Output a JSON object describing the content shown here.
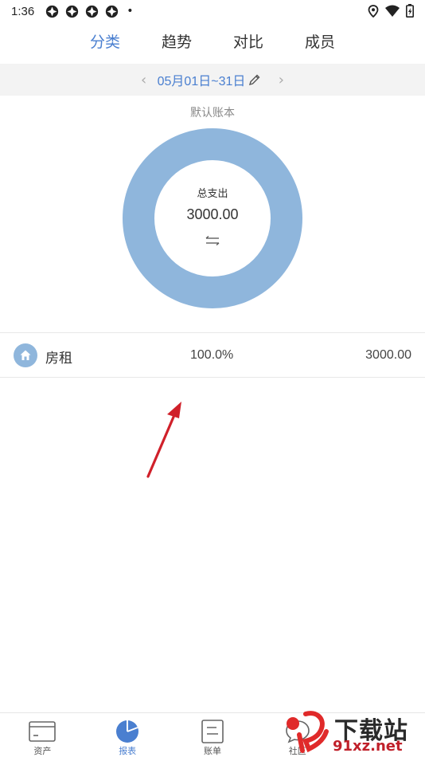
{
  "status_bar": {
    "time": "1:36",
    "dot": "•"
  },
  "top_tabs": [
    {
      "label": "分类",
      "active": true
    },
    {
      "label": "趋势",
      "active": false
    },
    {
      "label": "对比",
      "active": false
    },
    {
      "label": "成员",
      "active": false
    }
  ],
  "date_bar": {
    "prev": "‹",
    "range": "05月01日~31日",
    "next": "›"
  },
  "chart": {
    "ledger_name": "默认账本",
    "center_label": "总支出",
    "center_total": "3000.00",
    "ring_color": "#8fb6dc"
  },
  "chart_data": {
    "type": "pie",
    "categories": [
      "房租"
    ],
    "values": [
      3000.0
    ],
    "title": "默认账本"
  },
  "categories": [
    {
      "name": "房租",
      "percent": "100.0%",
      "amount": "3000.00",
      "icon": "home-icon"
    }
  ],
  "bottom_nav": [
    {
      "label": "资产",
      "icon": "card-icon",
      "active": false
    },
    {
      "label": "报表",
      "icon": "pie-chart-icon",
      "active": true
    },
    {
      "label": "账单",
      "icon": "document-icon",
      "active": false
    },
    {
      "label": "社区",
      "icon": "chat-icon",
      "active": false
    }
  ],
  "watermark": {
    "title": "下载站",
    "site": "91xz.net"
  },
  "colors": {
    "accent": "#4a7fd0",
    "annotation_arrow": "#d0202a"
  }
}
